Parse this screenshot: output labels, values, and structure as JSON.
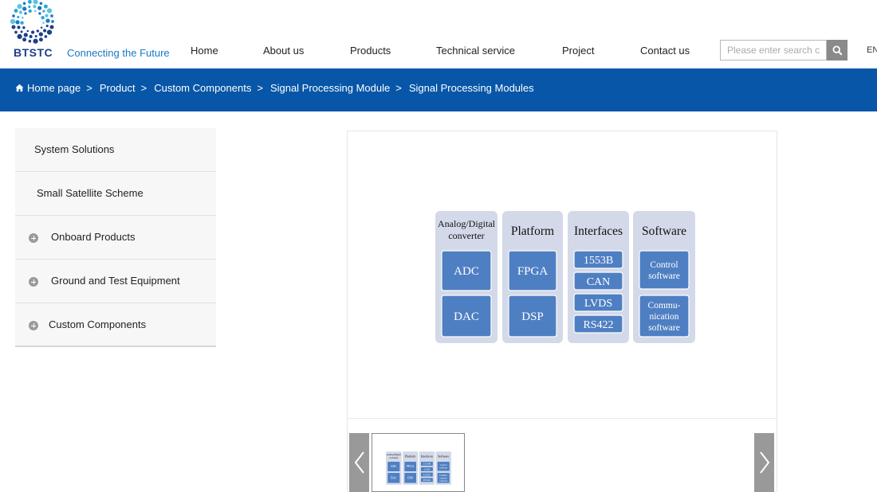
{
  "brand": {
    "name": "BTSTC",
    "tagline": "Connecting the Future"
  },
  "nav": {
    "items": [
      {
        "label": "Home"
      },
      {
        "label": "About us"
      },
      {
        "label": "Products"
      },
      {
        "label": "Technical service"
      },
      {
        "label": "Project"
      },
      {
        "label": "Contact us"
      }
    ]
  },
  "search": {
    "placeholder": "Please enter search co",
    "icon": "search-icon"
  },
  "lang": "EN",
  "breadcrumb": {
    "icon": "home-icon",
    "items": [
      "Home page",
      "Product",
      "Custom Components",
      "Signal Processing Module",
      "Signal Processing Modules"
    ],
    "separator": ">"
  },
  "sidebar": {
    "items": [
      {
        "label": "System Solutions",
        "expandable": false
      },
      {
        "label": "Small Satellite Scheme",
        "expandable": false
      },
      {
        "label": "Onboard Products",
        "expandable": true
      },
      {
        "label": "Ground and Test Equipment",
        "expandable": true
      },
      {
        "label": "Custom Components",
        "expandable": true
      }
    ]
  },
  "diagram": {
    "columns": [
      {
        "title": "Analog/Digital converter",
        "title_lines": [
          "Analog/Digital",
          "converter"
        ],
        "boxes": [
          "ADC",
          "DAC"
        ]
      },
      {
        "title": "Platform",
        "title_lines": [
          "Platform"
        ],
        "boxes": [
          "FPGA",
          "DSP"
        ]
      },
      {
        "title": "Interfaces",
        "title_lines": [
          "Interfaces"
        ],
        "boxes": [
          "1553B",
          "CAN",
          "LVDS",
          "RS422"
        ]
      },
      {
        "title": "Software",
        "title_lines": [
          "Software"
        ],
        "boxes": [
          "Control software",
          "Communication software"
        ],
        "box_lines": [
          [
            "Control",
            "software"
          ],
          [
            "Commu-",
            "nication",
            "software"
          ]
        ]
      }
    ]
  },
  "colors": {
    "brand_blue": "#0756a8",
    "logo_dark": "#1e3f8a",
    "tagline_blue": "#1a7ac4",
    "diagram_column_bg": "#d3d9e8",
    "diagram_box": "#4f7fc3"
  },
  "gallery": {
    "prev_icon": "chevron-left-icon",
    "next_icon": "chevron-right-icon"
  }
}
